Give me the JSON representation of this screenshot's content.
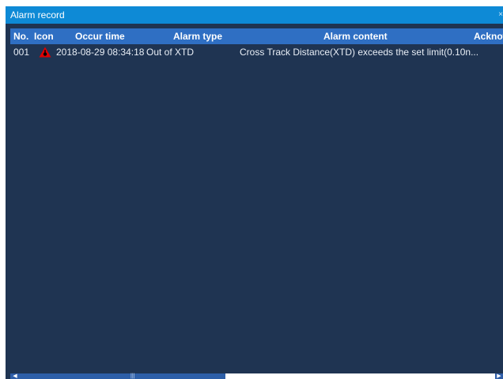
{
  "window": {
    "title": "Alarm record"
  },
  "table": {
    "columns": [
      "No.",
      "Icon",
      "Occur time",
      "Alarm type",
      "Alarm content",
      "Acknow"
    ],
    "rows": [
      {
        "no": "001",
        "icon": "warning-triangle-icon",
        "time": "2018-08-29 08:34:18",
        "type": "Out of XTD",
        "content": "Cross Track Distance(XTD) exceeds the set limit(0.10n..."
      }
    ]
  },
  "colors": {
    "title_bar": "#0e8ad6",
    "header": "#2f6fc3",
    "body_bg": "#1f3452",
    "warning_red": "#e00000"
  }
}
